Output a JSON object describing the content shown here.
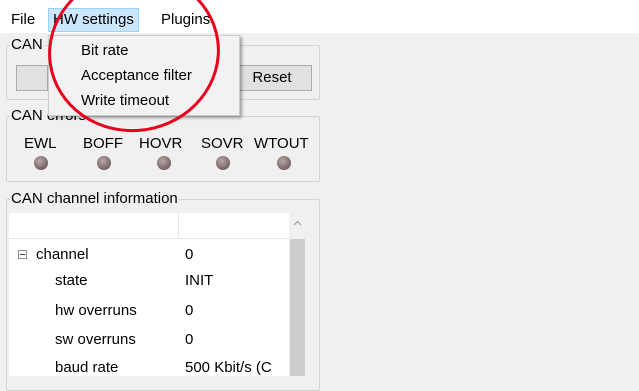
{
  "menubar": {
    "file": "File",
    "hw_settings": "HW settings",
    "plugins": "Plugins"
  },
  "hw_menu": {
    "items": [
      "Bit rate",
      "Acceptance filter",
      "Write timeout"
    ]
  },
  "can_group": {
    "legend": "CAN",
    "reset_label": "Reset"
  },
  "can_errors": {
    "legend": "CAN errors",
    "labels": [
      "EWL",
      "BOFF",
      "HOVR",
      "SOVR",
      "WTOUT"
    ],
    "led_color": "#7a6666"
  },
  "channel_info": {
    "legend": "CAN channel information",
    "rows": [
      {
        "name": "channel",
        "value": "0"
      },
      {
        "name": "state",
        "value": "INIT"
      },
      {
        "name": "hw overruns",
        "value": "0"
      },
      {
        "name": "sw overruns",
        "value": "0"
      },
      {
        "name": "baud rate",
        "value": "500  Kbit/s  (C"
      }
    ]
  },
  "colors": {
    "menu_highlight": "#cce8ff",
    "annotation_circle": "#e8001c"
  }
}
